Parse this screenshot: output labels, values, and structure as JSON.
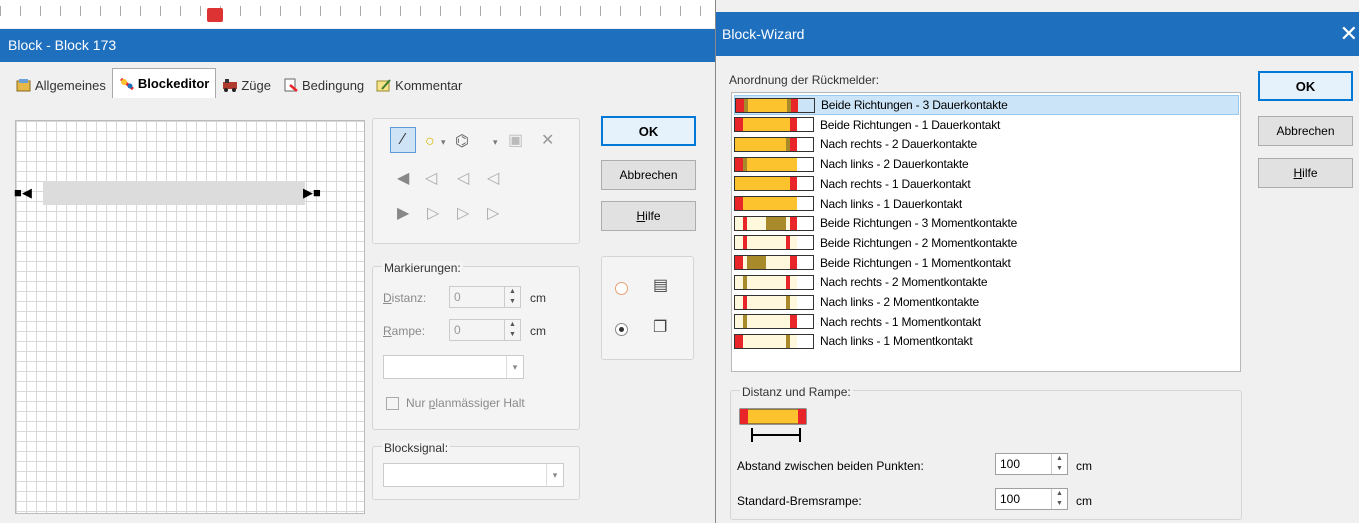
{
  "main": {
    "title": "Block - Block 173",
    "tabs": [
      {
        "label": "Allgemeines"
      },
      {
        "label": "Blockeditor"
      },
      {
        "label": "Züge"
      },
      {
        "label": "Bedingung"
      },
      {
        "label": "Kommentar"
      }
    ],
    "buttons": {
      "ok": "OK",
      "cancel": "Abbrechen",
      "help_first": "H",
      "help_rest": "ilfe"
    },
    "markierungen": {
      "legend": "Markierungen:",
      "distanz_first": "D",
      "distanz_rest": "istanz:",
      "distanz_value": "0",
      "rampe_first": "R",
      "rampe_rest": "ampe:",
      "rampe_value": "0",
      "unit": "cm",
      "checkbox_pre": "Nur ",
      "checkbox_u": "p",
      "checkbox_post": "lanmässiger Halt"
    },
    "blocksignal": {
      "legend": "Blocksignal:"
    }
  },
  "wizard": {
    "title": "Block-Wizard",
    "close": "✕",
    "list_label": "Anordnung der Rückmelder:",
    "items": [
      {
        "label": "Beide Richtungen - 3 Dauerkontakte",
        "pattern": [
          "red",
          "olive",
          "yellow",
          "yellow",
          "olive",
          "red"
        ]
      },
      {
        "label": "Beide Richtungen - 1 Dauerkontakt",
        "pattern": [
          "red",
          "yellow",
          "yellow",
          "yellow",
          "yellow",
          "red"
        ]
      },
      {
        "label": "Nach rechts - 2 Dauerkontakte",
        "pattern": [
          "yellow",
          "yellow",
          "yellow",
          "yellow",
          "olive",
          "red"
        ]
      },
      {
        "label": "Nach links - 2 Dauerkontakte",
        "pattern": [
          "red",
          "olive",
          "yellow",
          "yellow",
          "yellow",
          "yellow"
        ]
      },
      {
        "label": "Nach rechts - 1 Dauerkontakt",
        "pattern": [
          "yellow",
          "yellow",
          "yellow",
          "yellow",
          "yellow",
          "red"
        ]
      },
      {
        "label": "Nach links - 1 Dauerkontakt",
        "pattern": [
          "red",
          "yellow",
          "yellow",
          "yellow",
          "yellow",
          "yellow"
        ]
      },
      {
        "label": "Beide Richtungen - 3 Momentkontakte",
        "pattern": [
          "cream",
          "red",
          "cream",
          "olive",
          "cream",
          "red"
        ]
      },
      {
        "label": "Beide Richtungen - 2 Momentkontakte",
        "pattern": [
          "cream",
          "red",
          "cream",
          "cream",
          "red",
          "cream"
        ]
      },
      {
        "label": "Beide Richtungen - 1 Momentkontakt",
        "pattern": [
          "red",
          "cream",
          "olive",
          "cream",
          "cream",
          "red"
        ]
      },
      {
        "label": "Nach rechts - 2 Momentkontakte",
        "pattern": [
          "cream",
          "olive",
          "cream",
          "cream",
          "red",
          "cream"
        ]
      },
      {
        "label": "Nach links - 2 Momentkontakte",
        "pattern": [
          "cream",
          "red",
          "cream",
          "cream",
          "olive",
          "cream"
        ]
      },
      {
        "label": "Nach rechts - 1 Momentkontakt",
        "pattern": [
          "cream",
          "olive",
          "cream",
          "cream",
          "cream",
          "red"
        ]
      },
      {
        "label": "Nach links - 1 Momentkontakt",
        "pattern": [
          "red",
          "cream",
          "cream",
          "cream",
          "olive",
          "cream"
        ]
      }
    ],
    "selected_index": 0,
    "buttons": {
      "ok": "OK",
      "cancel": "Abbrechen",
      "help_first": "H",
      "help_rest": "ilfe"
    },
    "distance": {
      "legend": "Distanz und Rampe:",
      "abstand_label": "Abstand zwischen beiden Punkten:",
      "abstand_value": "100",
      "rampe_label": "Standard-Bremsrampe:",
      "rampe_value": "100",
      "unit": "cm"
    }
  },
  "colors": {
    "title_bar": "#1f6fbf",
    "red": "#e8262a",
    "yellow": "#fcc32f",
    "olive": "#a88a2a",
    "cream": "#fff8dc"
  }
}
